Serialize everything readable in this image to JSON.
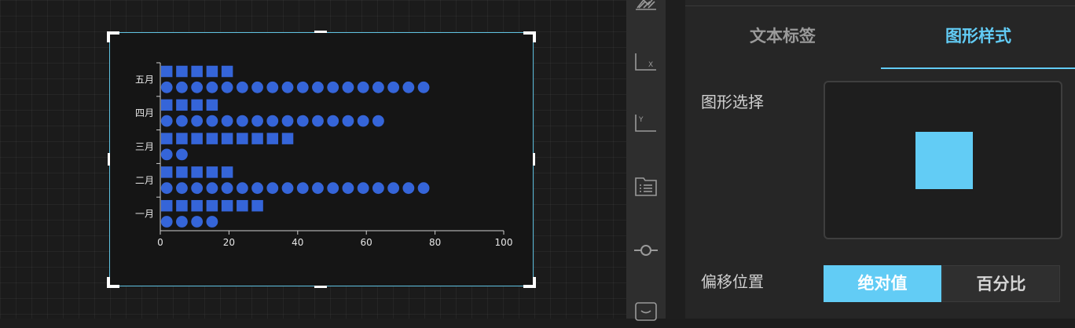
{
  "chart_data": {
    "type": "pictorial-bar",
    "categories": [
      "一月",
      "二月",
      "三月",
      "四月",
      "五月"
    ],
    "series": [
      {
        "shape": "circle",
        "values": [
          16,
          81,
          8,
          68,
          77
        ],
        "color": "#3565d9"
      },
      {
        "shape": "square",
        "values": [
          30,
          21,
          38,
          17,
          22
        ],
        "color": "#3565d9"
      }
    ],
    "xlim": [
      0,
      100
    ],
    "xticks": [
      "0",
      "20",
      "40",
      "60",
      "80",
      "100"
    ],
    "symbol_step": 4.4,
    "grid": false
  },
  "panel": {
    "tabs": [
      {
        "label": "文本标签",
        "active": false
      },
      {
        "label": "图形样式",
        "active": true
      }
    ],
    "shape_select_label": "图形选择",
    "selected_shape": "square",
    "offset_label": "偏移位置",
    "offset_options": [
      {
        "label": "绝对值",
        "active": true
      },
      {
        "label": "百分比",
        "active": false
      }
    ],
    "accent": "#62ccf5"
  },
  "toolbar": {
    "icons": [
      "chart-area-icon",
      "x-axis-icon",
      "y-axis-icon",
      "legend-icon",
      "marker-icon",
      "tooltip-icon"
    ],
    "x_axis_letter": "X",
    "y_axis_letter": "Y"
  }
}
